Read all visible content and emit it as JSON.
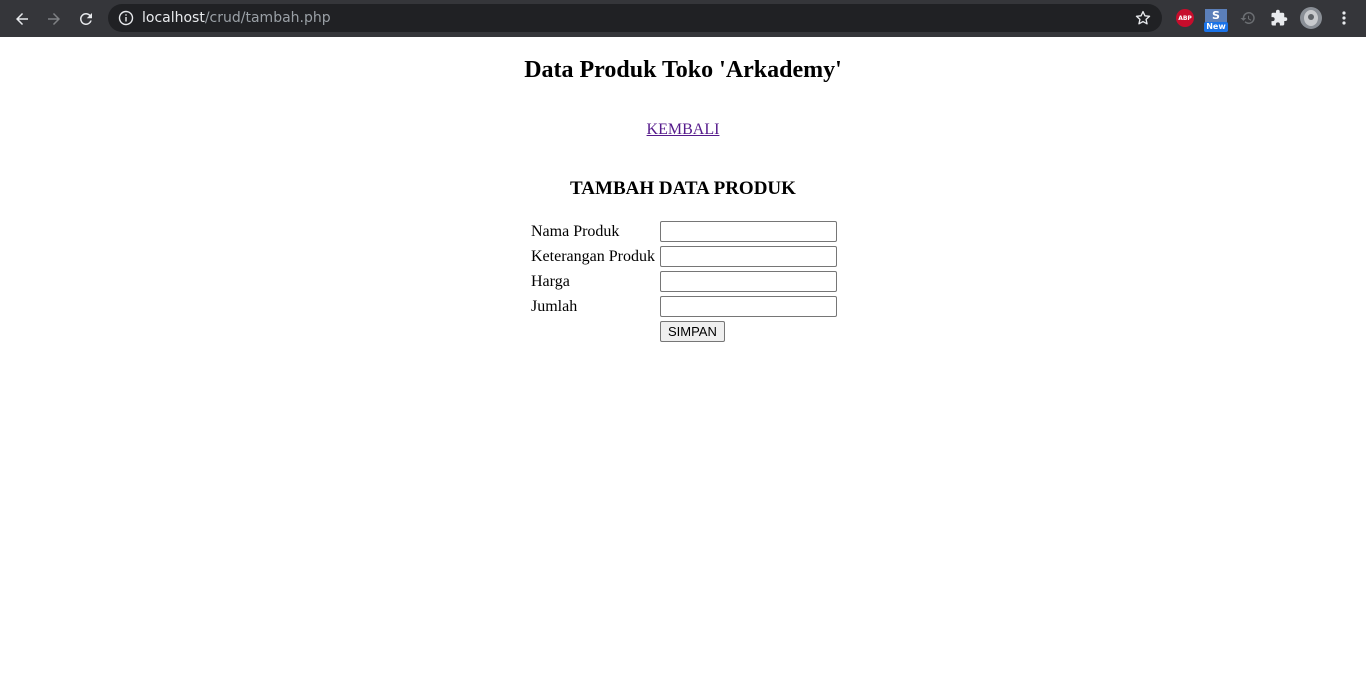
{
  "browser": {
    "url_host": "localhost",
    "url_path": "/crud/tambah.php",
    "extensions": {
      "abp_label": "ABP",
      "s_label": "S",
      "new_badge": "New"
    },
    "icons": [
      "back-icon",
      "forward-icon",
      "reload-icon",
      "info-icon",
      "star-icon",
      "history-icon",
      "puzzle-icon",
      "avatar",
      "more-vert-icon"
    ]
  },
  "page": {
    "title": "Data Produk Toko 'Arkademy'",
    "back_link": "KEMBALI",
    "form_title": "TAMBAH DATA PRODUK",
    "fields": [
      {
        "label": "Nama Produk",
        "value": ""
      },
      {
        "label": "Keterangan Produk",
        "value": ""
      },
      {
        "label": "Harga",
        "value": ""
      },
      {
        "label": "Jumlah",
        "value": ""
      }
    ],
    "submit_label": "SIMPAN"
  },
  "colors": {
    "chrome_bg": "#35363a",
    "omnibox_bg": "#202124",
    "visited_link": "#551a8b"
  }
}
